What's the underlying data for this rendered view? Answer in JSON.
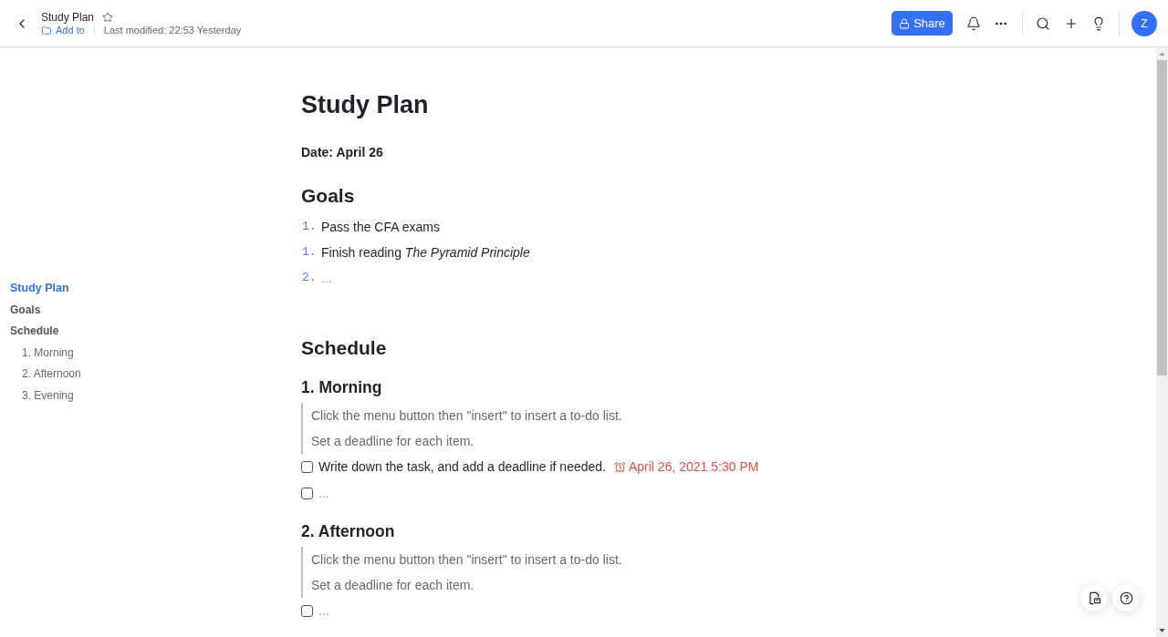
{
  "header": {
    "title": "Study Plan",
    "starred": false,
    "add_to": "Add to",
    "last_modified": "Last modified: 22:53 Yesterday",
    "share": "Share",
    "avatar": "Z"
  },
  "outline": [
    {
      "label": "Study Plan",
      "selected": true
    },
    {
      "label": "Goals",
      "selected": false
    },
    {
      "label": "Schedule",
      "selected": false,
      "children": [
        {
          "label": "1. Morning",
          "selected": false
        },
        {
          "label": "2. Afternoon",
          "selected": false
        },
        {
          "label": "3. Evening",
          "selected": false
        }
      ]
    }
  ],
  "document": {
    "title": "Study Plan",
    "date": "Date: April 26",
    "sections": [
      {
        "heading": "Goals",
        "items": [
          {
            "marker": "1.",
            "text": "Pass the CFA exams",
            "placeholder": false
          },
          {
            "marker": "1.",
            "text": "Finish reading *The Pyramid Principle*",
            "placeholder": false
          },
          {
            "marker": "2.",
            "text": "...",
            "placeholder": true
          }
        ]
      },
      {
        "heading": "Schedule",
        "subsections": [
          {
            "heading": "1. Morning",
            "notes": [
              "Click the menu button then \"insert\" to insert a to-do list.",
              "Set a deadline for each item."
            ],
            "todos": [
              {
                "text": "Write down the task, and add a deadline if needed.",
                "checked": false,
                "placeholder": false,
                "deadline": "April 26, 2021 5:30 PM"
              },
              {
                "text": "...",
                "checked": false,
                "placeholder": true
              }
            ]
          },
          {
            "heading": "2. Afternoon",
            "notes": [
              "Click the menu button then \"insert\" to insert a to-do list.",
              "Set a deadline for each item."
            ],
            "todos": [
              {
                "text": "...",
                "checked": false,
                "placeholder": true
              }
            ]
          }
        ]
      }
    ]
  }
}
